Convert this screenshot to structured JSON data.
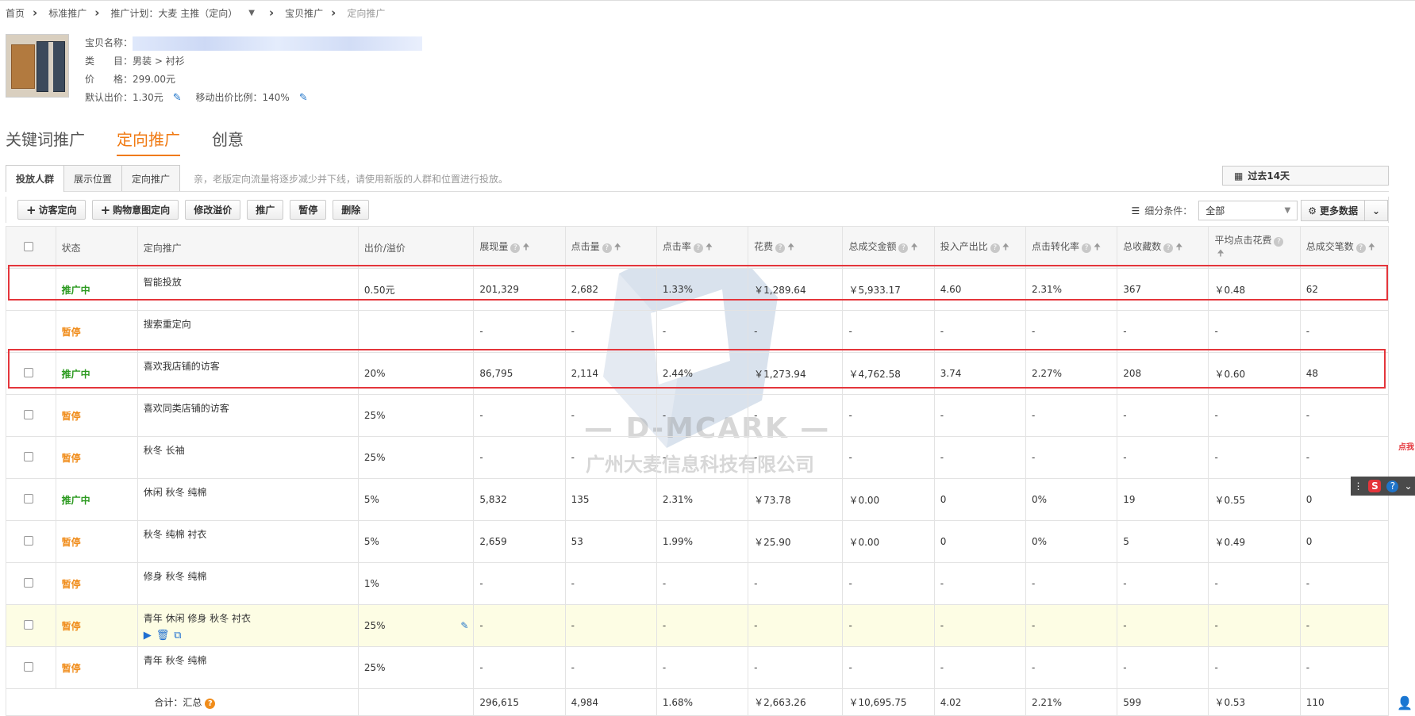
{
  "breadcrumb": {
    "home": "首页",
    "standard": "标准推广",
    "plan": "推广计划：大麦 主推（定向）",
    "item": "宝贝推广",
    "current": "定向推广"
  },
  "product": {
    "name_label": "宝贝名称：",
    "category_label": "类　　目：",
    "category_value": "男装 > 衬衫",
    "price_label": "价　　格：",
    "price_value": "299.00元",
    "default_bid_label": "默认出价：",
    "default_bid_value": "1.30元",
    "mobile_ratio_label": "移动出价比例：",
    "mobile_ratio_value": "140%"
  },
  "main_tabs": [
    "关键词推广",
    "定向推广",
    "创意"
  ],
  "sub_tabs": [
    "投放人群",
    "展示位置",
    "定向推广"
  ],
  "notice": "亲，老版定向流量将逐步减少并下线，请使用新版的人群和位置进行投放。",
  "date_range": "过去14天",
  "toolbar": {
    "visitor": "访客定向",
    "shopping": "购物意图定向",
    "modify": "修改溢价",
    "promote": "推广",
    "pause": "暂停",
    "delete": "删除",
    "filter_label": "细分条件：",
    "filter_value": "全部",
    "more_data": "更多数据"
  },
  "columns": [
    "状态",
    "定向推广",
    "出价/溢价",
    "展现量",
    "点击量",
    "点击率",
    "花费",
    "总成交金额",
    "投入产出比",
    "点击转化率",
    "总收藏数",
    "平均点击花费",
    "总成交笔数"
  ],
  "rows": [
    {
      "status": "推广中",
      "name": "智能投放",
      "bid": "0.50元",
      "impr": "201,329",
      "clicks": "2,682",
      "ctr": "1.33%",
      "cost": "￥1,289.64",
      "gmv": "￥5,933.17",
      "roi": "4.60",
      "cvr": "2.31%",
      "fav": "367",
      "cpc": "￥0.48",
      "orders": "62"
    },
    {
      "status": "暂停",
      "name": "搜索重定向",
      "bid": "",
      "impr": "-",
      "clicks": "-",
      "ctr": "-",
      "cost": "-",
      "gmv": "-",
      "roi": "-",
      "cvr": "-",
      "fav": "-",
      "cpc": "-",
      "orders": "-"
    },
    {
      "status": "推广中",
      "name": "喜欢我店铺的访客",
      "bid": "20%",
      "impr": "86,795",
      "clicks": "2,114",
      "ctr": "2.44%",
      "cost": "￥1,273.94",
      "gmv": "￥4,762.58",
      "roi": "3.74",
      "cvr": "2.27%",
      "fav": "208",
      "cpc": "￥0.60",
      "orders": "48"
    },
    {
      "status": "暂停",
      "name": "喜欢同类店铺的访客",
      "bid": "25%",
      "impr": "-",
      "clicks": "-",
      "ctr": "-",
      "cost": "-",
      "gmv": "-",
      "roi": "-",
      "cvr": "-",
      "fav": "-",
      "cpc": "-",
      "orders": "-"
    },
    {
      "status": "暂停",
      "name": "秋冬 长袖",
      "bid": "25%",
      "impr": "-",
      "clicks": "-",
      "ctr": "-",
      "cost": "-",
      "gmv": "-",
      "roi": "-",
      "cvr": "-",
      "fav": "-",
      "cpc": "-",
      "orders": "-"
    },
    {
      "status": "推广中",
      "name": "休闲 秋冬 纯棉",
      "bid": "5%",
      "impr": "5,832",
      "clicks": "135",
      "ctr": "2.31%",
      "cost": "￥73.78",
      "gmv": "￥0.00",
      "roi": "0",
      "cvr": "0%",
      "fav": "19",
      "cpc": "￥0.55",
      "orders": "0"
    },
    {
      "status": "暂停",
      "name": "秋冬 纯棉 衬衣",
      "bid": "5%",
      "impr": "2,659",
      "clicks": "53",
      "ctr": "1.99%",
      "cost": "￥25.90",
      "gmv": "￥0.00",
      "roi": "0",
      "cvr": "0%",
      "fav": "5",
      "cpc": "￥0.49",
      "orders": "0"
    },
    {
      "status": "暂停",
      "name": "修身 秋冬 纯棉",
      "bid": "1%",
      "impr": "-",
      "clicks": "-",
      "ctr": "-",
      "cost": "-",
      "gmv": "-",
      "roi": "-",
      "cvr": "-",
      "fav": "-",
      "cpc": "-",
      "orders": "-"
    },
    {
      "status": "暂停",
      "name": "青年 休闲 修身 秋冬 衬衣",
      "bid": "25%",
      "impr": "-",
      "clicks": "-",
      "ctr": "-",
      "cost": "-",
      "gmv": "-",
      "roi": "-",
      "cvr": "-",
      "fav": "-",
      "cpc": "-",
      "orders": "-"
    },
    {
      "status": "暂停",
      "name": "青年 秋冬 纯棉",
      "bid": "25%",
      "impr": "-",
      "clicks": "-",
      "ctr": "-",
      "cost": "-",
      "gmv": "-",
      "roi": "-",
      "cvr": "-",
      "fav": "-",
      "cpc": "-",
      "orders": "-"
    }
  ],
  "summary": {
    "label": "合计：汇总",
    "impr": "296,615",
    "clicks": "4,984",
    "ctr": "1.68%",
    "cost": "￥2,663.26",
    "gmv": "￥10,695.75",
    "roi": "4.02",
    "cvr": "2.21%",
    "fav": "599",
    "cpc": "￥0.53",
    "orders": "110"
  },
  "watermark": {
    "brand": "— D-MCARK —",
    "company": "广州大麦信息科技有限公司"
  },
  "side": {
    "corner_tag": "点我"
  },
  "colors": {
    "accent": "#f07a13",
    "active_status": "#2c9a20",
    "paused_status": "#f08c1a",
    "highlight_box": "#e4353b",
    "link_blue": "#1f74c9"
  }
}
